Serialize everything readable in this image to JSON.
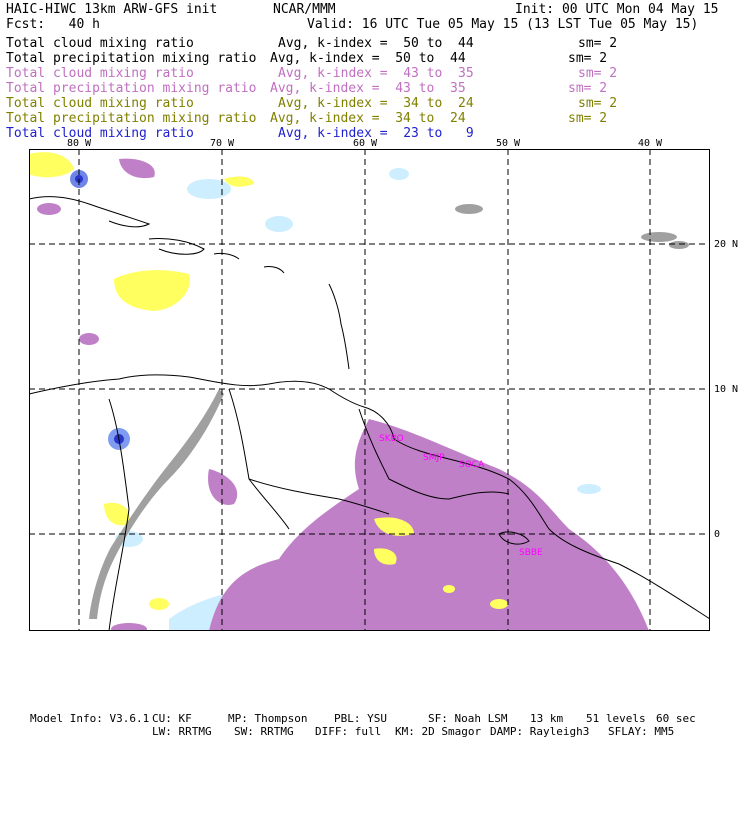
{
  "header": {
    "model_title": "HAIC-HIWC 13km ARW-GFS init",
    "org": "NCAR/MMM",
    "init": "Init: 00 UTC Mon 04 May 15",
    "fcst": "Fcst:   40 h",
    "valid": "Valid: 16 UTC Tue 05 May 15 (13 LST Tue 05 May 15)"
  },
  "legend_rows": [
    {
      "field": "Total cloud mixing ratio",
      "avg": "Avg, k-index =  50 to  44",
      "sm": "sm= 2",
      "color": "#000000"
    },
    {
      "field": "Total precipitation mixing ratio",
      "avg": "Avg, k-index =  50 to  44",
      "sm": "sm= 2",
      "color": "#000000"
    },
    {
      "field": "Total cloud mixing ratio",
      "avg": "Avg, k-index =  43 to  35",
      "sm": "sm= 2",
      "color": "#c070c0"
    },
    {
      "field": "Total precipitation mixing ratio",
      "avg": "Avg, k-index =  43 to  35",
      "sm": "sm= 2",
      "color": "#c070c0"
    },
    {
      "field": "Total cloud mixing ratio",
      "avg": "Avg, k-index =  34 to  24",
      "sm": "sm= 2",
      "color": "#808000"
    },
    {
      "field": "Total precipitation mixing ratio",
      "avg": "Avg, k-index =  34 to  24",
      "sm": "sm= 2",
      "color": "#808000"
    },
    {
      "field": "Total cloud mixing ratio",
      "avg": "Avg, k-index =  23 to   9",
      "sm": "",
      "color": "#2020d0"
    }
  ],
  "map": {
    "lon_labels": [
      "80 W",
      "70 W",
      "60 W",
      "50 W",
      "40 W"
    ],
    "lat_labels": [
      "20 N",
      "10 N",
      "0"
    ],
    "stations": [
      "SKBO",
      "SMJP",
      "SOCA",
      "SBBE"
    ],
    "colors": {
      "cloud_low": "#b8b8b8",
      "precip_low": "#808080",
      "cloud_mid": "#c080c8",
      "cloud_high": "#ffff60",
      "precip_high": "#cceeff",
      "deep": "#3030d0"
    }
  },
  "footer": {
    "row1": [
      "Model Info: V3.6.1",
      "CU: KF",
      "MP: Thompson",
      "PBL: YSU",
      "SF: Noah LSM",
      "13 km",
      "51 levels",
      "60 sec"
    ],
    "row2": [
      "LW: RRTMG",
      "SW: RRTMG",
      "DIFF: full",
      "KM: 2D Smagor",
      "DAMP: Rayleigh3",
      "SFLAY: MM5"
    ]
  }
}
